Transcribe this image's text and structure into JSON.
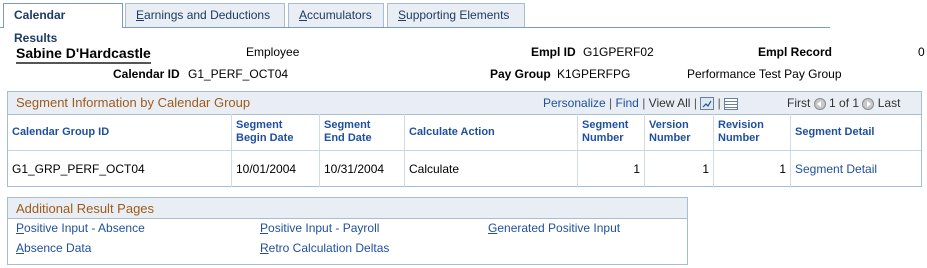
{
  "tabs": [
    {
      "label": "Calendar Results",
      "accesskey": "",
      "rest": "",
      "active": true
    },
    {
      "label": "Earnings and Deductions",
      "accesskey": "E",
      "rest": "arnings and Deductions"
    },
    {
      "label": "Accumulators",
      "accesskey": "A",
      "rest": "ccumulators"
    },
    {
      "label": "Supporting Elements",
      "accesskey": "S",
      "rest": "upporting Elements"
    }
  ],
  "header": {
    "employee_name": "Sabine D'Hardcastle",
    "employee_label": "Employee",
    "empl_id_label": "Empl ID",
    "empl_id_value": "G1GPERF02",
    "empl_record_label": "Empl Record",
    "empl_record_value": "0",
    "calendar_id_label": "Calendar ID",
    "calendar_id_value": "G1_PERF_OCT04",
    "pay_group_label": "Pay Group",
    "pay_group_value": "K1GPERFPG",
    "pay_group_desc": "Performance Test Pay Group"
  },
  "segment_grid": {
    "title": "Segment Information by Calendar Group",
    "personalize": "Personalize",
    "find": "Find",
    "view_all": "View All",
    "first": "First",
    "pagination": "1 of 1",
    "last": "Last",
    "columns": [
      {
        "line1": "Calendar Group ID",
        "line2": ""
      },
      {
        "line1": "Segment",
        "line2": "Begin Date"
      },
      {
        "line1": "Segment",
        "line2": "End Date"
      },
      {
        "line1": "Calculate Action",
        "line2": ""
      },
      {
        "line1": "Segment",
        "line2": "Number"
      },
      {
        "line1": "Version",
        "line2": "Number"
      },
      {
        "line1": "Revision",
        "line2": "Number"
      },
      {
        "line1": "Segment Detail",
        "line2": ""
      }
    ],
    "rows": [
      {
        "calendar_group_id": "G1_GRP_PERF_OCT04",
        "begin_date": "10/01/2004",
        "end_date": "10/31/2004",
        "calculate_action": "Calculate",
        "segment_number": "1",
        "version_number": "1",
        "revision_number": "1",
        "segment_detail": "Segment Detail"
      }
    ]
  },
  "additional_pages": {
    "title": "Additional Result Pages",
    "links": [
      {
        "label": "Positive Input - Absence",
        "accesskey": "P",
        "rest": "ositive Input - Absence"
      },
      {
        "label": "Positive Input - Payroll",
        "accesskey": "P",
        "rest": "ositive Input - Payroll"
      },
      {
        "label": "Generated Positive Input",
        "accesskey": "G",
        "rest": "enerated Positive Input"
      },
      {
        "label": "Absence Data",
        "accesskey": "A",
        "rest": "bsence Data"
      },
      {
        "label": "Retro Calculation Deltas",
        "accesskey": "R",
        "rest": "etro Calculation Deltas"
      }
    ]
  }
}
